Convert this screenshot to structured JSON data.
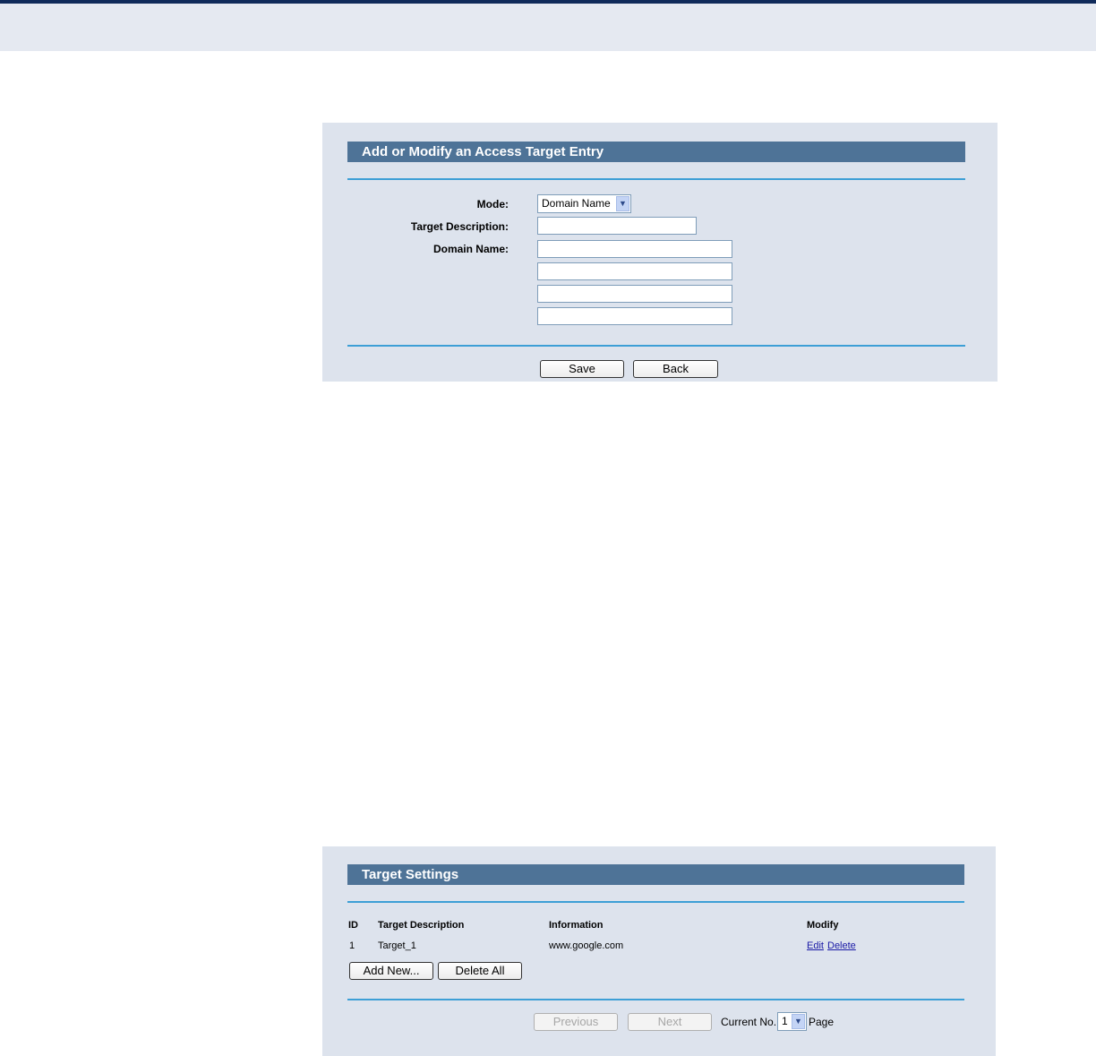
{
  "edit_form": {
    "title": "Add or Modify an Access Target Entry",
    "mode_label": "Mode:",
    "mode_value": "Domain Name",
    "target_description_label": "Target Description:",
    "target_description_value": "",
    "domain_name_label": "Domain Name:",
    "domain_names": [
      "",
      "",
      "",
      ""
    ],
    "save_label": "Save",
    "back_label": "Back"
  },
  "target_settings": {
    "title": "Target Settings",
    "columns": [
      "ID",
      "Target Description",
      "Information",
      "Modify"
    ],
    "rows": [
      {
        "id": "1",
        "description": "Target_1",
        "information": "www.google.com",
        "edit": "Edit",
        "delete": "Delete"
      }
    ],
    "add_new_label": "Add New...",
    "delete_all_label": "Delete All",
    "previous_label": "Previous",
    "next_label": "Next",
    "current_no_label": "Current No.",
    "current_page": "1",
    "page_label": "Page"
  },
  "colors": {
    "title_bar": "#4e7397",
    "panel_bg": "#dde3ed",
    "divider": "#3d9fd6",
    "top_border": "#0f2a5a",
    "link": "#1a1aa6"
  }
}
